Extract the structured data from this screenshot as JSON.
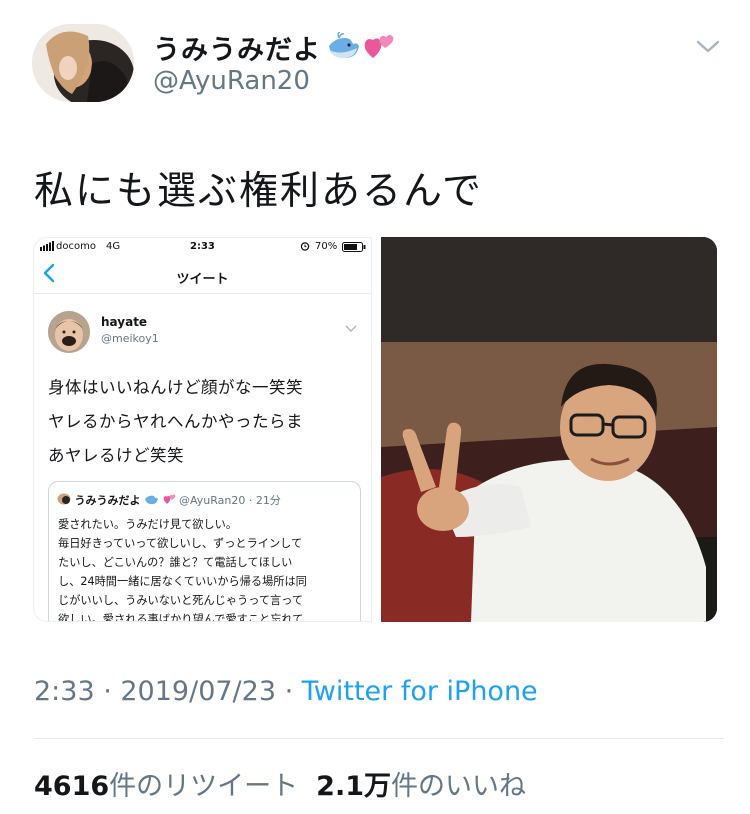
{
  "user": {
    "display_name": "うみうみだよ",
    "handle": "@AyuRan20"
  },
  "tweet": {
    "text": "私にも選ぶ権利あるんで"
  },
  "embedded_screenshot": {
    "carrier": "docomo",
    "network": "4G",
    "time": "2:33",
    "battery": "70%",
    "screen_title": "ツイート",
    "author_name": "hayate",
    "author_handle": "@meikoy1",
    "text_lines": [
      "身体はいいねんけど顔がな一笑笑",
      "ヤレるからヤれへんかやったらま",
      "あヤレるけど笑笑"
    ],
    "quoted": {
      "name": "うみうみだよ",
      "handle_time": "@AyuRan20 · 21分",
      "lines": [
        "愛されたい。うみだけ見て欲しい。",
        "毎日好きっていって欲しいし、ずっとラインして",
        "たいし、どこいんの？誰と？て電話してほしい",
        "し、24時間一緒に居なくていいから帰る場所は同",
        "じがいいし、うみいないと死んじゃうって言って",
        "欲しい。愛される事ばかり望んで愛すこと忘れて"
      ]
    }
  },
  "meta": {
    "time_date": "2:33 · 2019/07/23 · ",
    "source": "Twitter for iPhone"
  },
  "stats": {
    "retweet_count": "4616",
    "retweet_label": "件のリツイート",
    "like_count": "2.1万",
    "like_label": "件のいいね"
  },
  "colors": {
    "link": "#1da1f2",
    "secondary": "#657786",
    "primary_text": "#14171a"
  }
}
